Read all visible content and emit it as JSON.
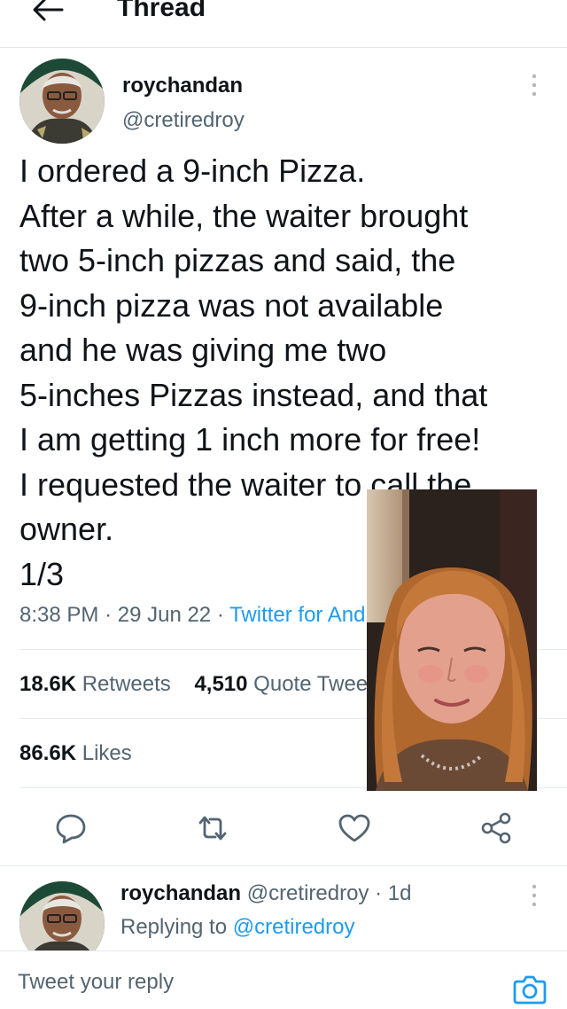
{
  "header": {
    "title": "Thread"
  },
  "tweet": {
    "author_name": "roychandan",
    "author_handle": "@cretiredroy",
    "lines": [
      "I ordered a 9-inch Pizza.",
      "After a while, the waiter  brought",
      "two 5-inch pizzas and said, the",
      "9-inch pizza was not available",
      "and he was giving me two",
      "5-inches Pizzas instead, and that",
      "I am getting 1 inch more for free!",
      "I requested  the waiter to call the",
      "owner.",
      "1/3"
    ],
    "time": "8:38 PM",
    "date": "29 Jun 22",
    "separator": "·",
    "source": "Twitter for Android",
    "retweets_count": "18.6K",
    "retweets_label": "Retweets",
    "quotes_count": "4,510",
    "quotes_label": "Quote Tweets",
    "likes_count": "86.6K",
    "likes_label": "Likes"
  },
  "actions": {
    "icons": [
      "reply-icon",
      "retweet-icon",
      "like-icon",
      "share-icon"
    ]
  },
  "reply": {
    "author_name": "roychandan",
    "author_handle": "@cretiredroy",
    "separator": "·",
    "age": "1d",
    "replying_prefix": "Replying to",
    "replying_to": "@cretiredroy"
  },
  "composer": {
    "placeholder": "Tweet your reply",
    "camera_icon": "camera-icon"
  },
  "colors": {
    "text": "#0f1419",
    "secondary": "#536471",
    "accent": "#1d9bf0",
    "divider": "#e6ecf0"
  }
}
